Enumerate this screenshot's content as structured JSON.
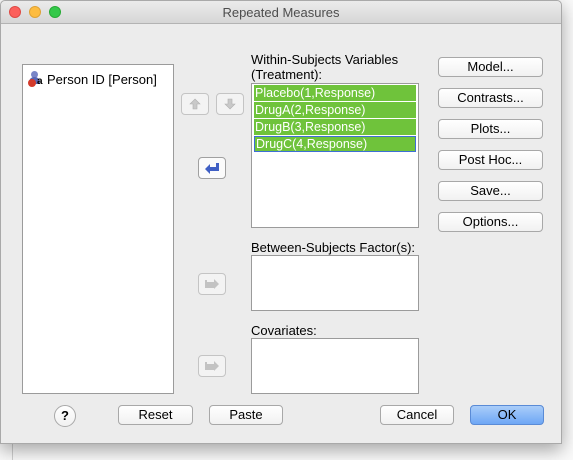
{
  "window": {
    "title": "Repeated Measures"
  },
  "source_list": {
    "items": [
      {
        "label": "Person ID [Person]",
        "icon": "nominal-variable-icon"
      }
    ]
  },
  "within": {
    "label_line1": "Within-Subjects Variables",
    "label_line2": "(Treatment):",
    "items": [
      "Placebo(1,Response)",
      "DrugA(2,Response)",
      "DrugB(3,Response)",
      "DrugC(4,Response)"
    ],
    "highlight_color": "#6fc33b"
  },
  "between": {
    "label": "Between-Subjects Factor(s):"
  },
  "covariates": {
    "label": "Covariates:"
  },
  "side_buttons": {
    "model": "Model...",
    "contrasts": "Contrasts...",
    "plots": "Plots...",
    "post_hoc": "Post Hoc...",
    "save": "Save...",
    "options": "Options..."
  },
  "bottom_buttons": {
    "help": "?",
    "reset": "Reset",
    "paste": "Paste",
    "cancel": "Cancel",
    "ok": "OK"
  }
}
